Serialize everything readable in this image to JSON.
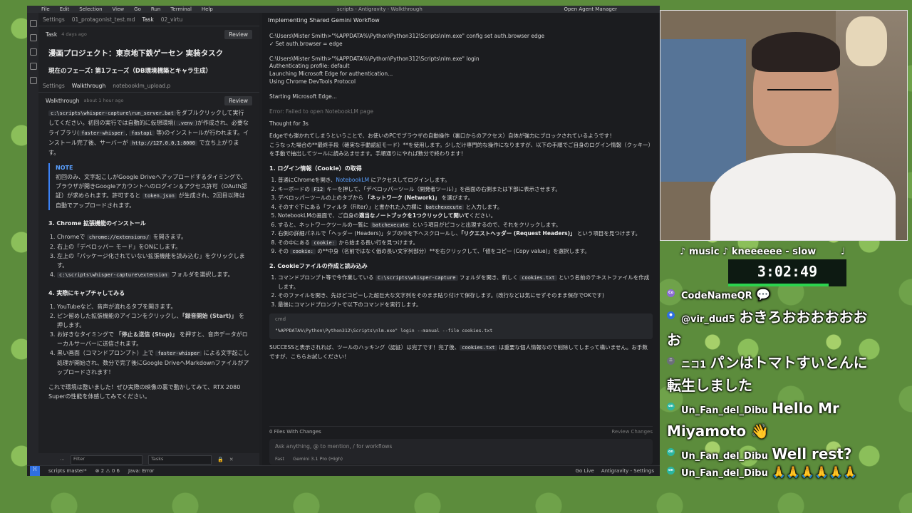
{
  "ide": {
    "menu": [
      "File",
      "Edit",
      "Selection",
      "View",
      "Go",
      "Run",
      "Terminal",
      "Help"
    ],
    "window_title": "scripts - Antigravity - Walkthrough",
    "agent_manager": "Open Agent Manager",
    "top_tabs": [
      "Settings",
      "01_protagonist_test.md",
      "Task",
      "02_virtu"
    ],
    "task_pane": {
      "title": "Task",
      "time": "4 days ago",
      "review": "Review"
    },
    "walk_tabs": [
      "Settings",
      "Walkthrough",
      "notebooklm_upload.p"
    ],
    "walk_pane": {
      "title": "Walkthrough",
      "time": "about 1 hour ago",
      "review": "Review"
    },
    "doc": {
      "h1": "漫画プロジェクト：東京地下鉄ゲーセン 実装タスク",
      "phase": "現在のフェーズ: 第1フェーズ（DB環境構築とキャラ生成）",
      "p1_code": "c:\\scripts\\whisper-capture\\run_server.bat",
      "p1_a": "をダブルクリックして実行してください。初回の実行では自動的に仮想環境(",
      "p1_venv": ".venv",
      "p1_b": ")が作成され、必要なライブラリ(",
      "p1_fw": "faster-whisper",
      "p1_comma": ", ",
      "p1_fa": "fastapi",
      "p1_c": " 等)のインストールが行われます。インストール完了後、サーバーが ",
      "p1_url": "http://127.0.0.1:8000",
      "p1_d": " で立ち上がります。",
      "note_title": "NOTE",
      "note_a": "初回のみ、文字起こしがGoogle Driveへアップロードするタイミングで、ブラウザが開きGoogleアカウントへのログイン＆アクセス許可（OAuth認証）が求められます。許可すると ",
      "note_token": "token.json",
      "note_b": " が生成され、2回目以降は自動でアップロードされます。",
      "h3_install": "3. Chrome 拡張機能のインストール",
      "install": [
        {
          "a": "Chromeで ",
          "code": "chrome://extensions/",
          "b": " を開きます。"
        },
        {
          "a": "右上の「デベロッパー モード」をONにします。",
          "code": "",
          "b": ""
        },
        {
          "a": "左上の「パッケージ化されていない拡張機能を読み込む」をクリックします。",
          "code": "",
          "b": ""
        },
        {
          "a": "",
          "code": "c:\\scripts\\whisper-capture\\extension",
          "b": " フォルダを選択します。"
        }
      ],
      "h3_capture": "4. 実際にキャプチャしてみる",
      "cap1": "YouTubeなど、音声が流れるタブを開きます。",
      "cap2_a": "ピン留めした拡張機能のアイコンをクリックし、",
      "cap2_b": "「録音開始 (Start)」",
      "cap2_c": " を押します。",
      "cap3_a": "お好きなタイミングで ",
      "cap3_b": "「停止＆送信 (Stop)」",
      "cap3_c": " を押すと、音声データがローカルサーバーに送信されます。",
      "cap4_a": "黒い画面（コマンドプロンプト）上で ",
      "cap4_code": "faster-whisper",
      "cap4_b": " による文字起こし処理が開始され、数分で完了後にGoogle DriveへMarkdownファイルがアップロードされます！",
      "closing": "これで環境は整いました！ぜひ実際の映像の裏で動かしてみて、RTX 2080 Superの性能を体感してみてください。"
    },
    "filter": {
      "placeholder": "Filter",
      "select": "Tasks"
    },
    "right": {
      "title": "Implementing Shared Gemini Workflow",
      "term": [
        "C:\\Users\\Mister Smith>\"%APPDATA%\\Python\\Python312\\Scripts\\nlm.exe\" config set auth.browser edge",
        "✓ Set auth.browser = edge",
        "",
        "C:\\Users\\Mister Smith>\"%APPDATA%\\Python\\Python312\\Scripts\\nlm.exe\" login",
        "Authenticating profile: default",
        "Launching Microsoft Edge for authentication...",
        "Using Chrome DevTools Protocol",
        "",
        "Starting Microsoft Edge...",
        "",
        "Error: Failed to open NotebookLM page"
      ],
      "thought": "Thought for 3s",
      "intro1": "Edgeでも弾かれてしまうということで、お使いのPCでブラウザの自動操作（裏口からのアクセス）自体が強力にブロックされているようです！",
      "intro2": "こうなった場合の**最終手段（確実な手動認証モード）**を使用します。少しだけ専門的な操作になりますが、以下の手順でご自身のログイン情報（クッキー）を手動で抽出してツールに読み込ませます。手順通りにやれば数分で終わります！",
      "h_cookie": "1. ログイン情報（Cookie）の取得",
      "s1_a": "普通にChromeを開き、",
      "s1_link": "NotebookLM",
      "s1_b": " にアクセスしてログインします。",
      "s2_a": "キーボードの ",
      "s2_code": "F12",
      "s2_b": " キーを押して、「デベロッパーツール（開発者ツール）」を画面の右側または下部に表示させます。",
      "s3_a": "デベロッパーツールの上のタブから ",
      "s3_b": "「ネットワーク (Network)」",
      "s3_c": " を選びます。",
      "s4_a": "そのすぐ下にある「フィルタ（Filter）」と書かれた入力欄に ",
      "s4_code": "batchexecute",
      "s4_b": " と入力します。",
      "s5_a": "NotebookLMの画面で、ご自身の",
      "s5_b": "適当なノートブックを1つクリックして開いて",
      "s5_c": "ください。",
      "s6_a": "すると、ネットワークツールの一覧に ",
      "s6_code": "batchexecute",
      "s6_b": " という項目がピコッと出現するので、それをクリックします。",
      "s7_a": "右側の詳細パネルで「ヘッダー (Headers)」タブの中を下へスクロールし、",
      "s7_b": "「リクエストヘッダー (Request Headers)」",
      "s7_c": " という項目を見つけます。",
      "s8_a": "その中にある ",
      "s8_code": "cookie:",
      "s8_b": " から始まる長い行を見つけます。",
      "s9_a": "その ",
      "s9_code": "cookie:",
      "s9_b": " の**中身（名前ではなく価の長い文字列部分）**を右クリックして、「値をコピー (Copy value)」を選択します。",
      "h_file": "2. Cookieファイルの作成と読み込み",
      "f1_a": "コマンドプロンプト等で今作業している ",
      "f1_code": "C:\\scripts\\whisper-capture",
      "f1_b": " フォルダを開き、新しく ",
      "f1_code2": "cookies.txt",
      "f1_c": " という名前のテキストファイルを作成します。",
      "f2": "そのファイルを開き、先ほどコピーした超巨大な文字列をそのまま貼り付けて保存します。(改行などは気にせずそのまま保存でOKです)",
      "f3": "最後にコマンドプロンプトで以下のコマンドを実行します。",
      "cmd_label": "cmd",
      "cmd": "\"%APPDATA%\\Python\\Python312\\Scripts\\nlm.exe\" login --manual --file cookies.txt",
      "success_a": "SUCCESSと表示されれば、ツールのハッキング（認証）は完了です！完了後、",
      "success_code": "cookies.txt",
      "success_b": " は重要な個人情報なので削除してしまって構いません。お手数ですが、こちらお試しください！",
      "changes": "0 Files With Changes",
      "review_changes": "Review Changes",
      "ask_placeholder": "Ask anything, @ to mention, / for workflows",
      "fast": "Fast",
      "model": "Gemini 3.1 Pro (High)"
    },
    "status": {
      "branch": "scripts master*",
      "errors": "⊗ 2  ⚠ 0  6",
      "java": "Java: Error",
      "go_live": "Go Live",
      "settings": "Antigravity - Settings"
    }
  },
  "stream": {
    "music": "♪ music ♪ kneeeeee - slow",
    "music_end": "♩",
    "timer": "3:02:49",
    "timer_progress": 0.85,
    "chat": [
      {
        "badge": "Co",
        "user": "CodeNameQR",
        "text": "",
        "emote": "💬"
      },
      {
        "badge": "●",
        "user": "@vir_dud5",
        "text": "おきろおおおおおおお"
      },
      {
        "badge": "ニ",
        "user": "ニコ1",
        "text": "パンはトマトすいとんに転生しました"
      },
      {
        "badge": "on",
        "user": "Un_Fan_del_Dibu",
        "text": "Hello Mr Miyamoto 👋"
      },
      {
        "badge": "on",
        "user": "Un_Fan_del_Dibu",
        "text": "Well rest?"
      },
      {
        "badge": "on",
        "user": "Un_Fan_del_Dibu",
        "text": "",
        "emote": "🙏🙏🙏🙏🙏🙏"
      }
    ]
  }
}
